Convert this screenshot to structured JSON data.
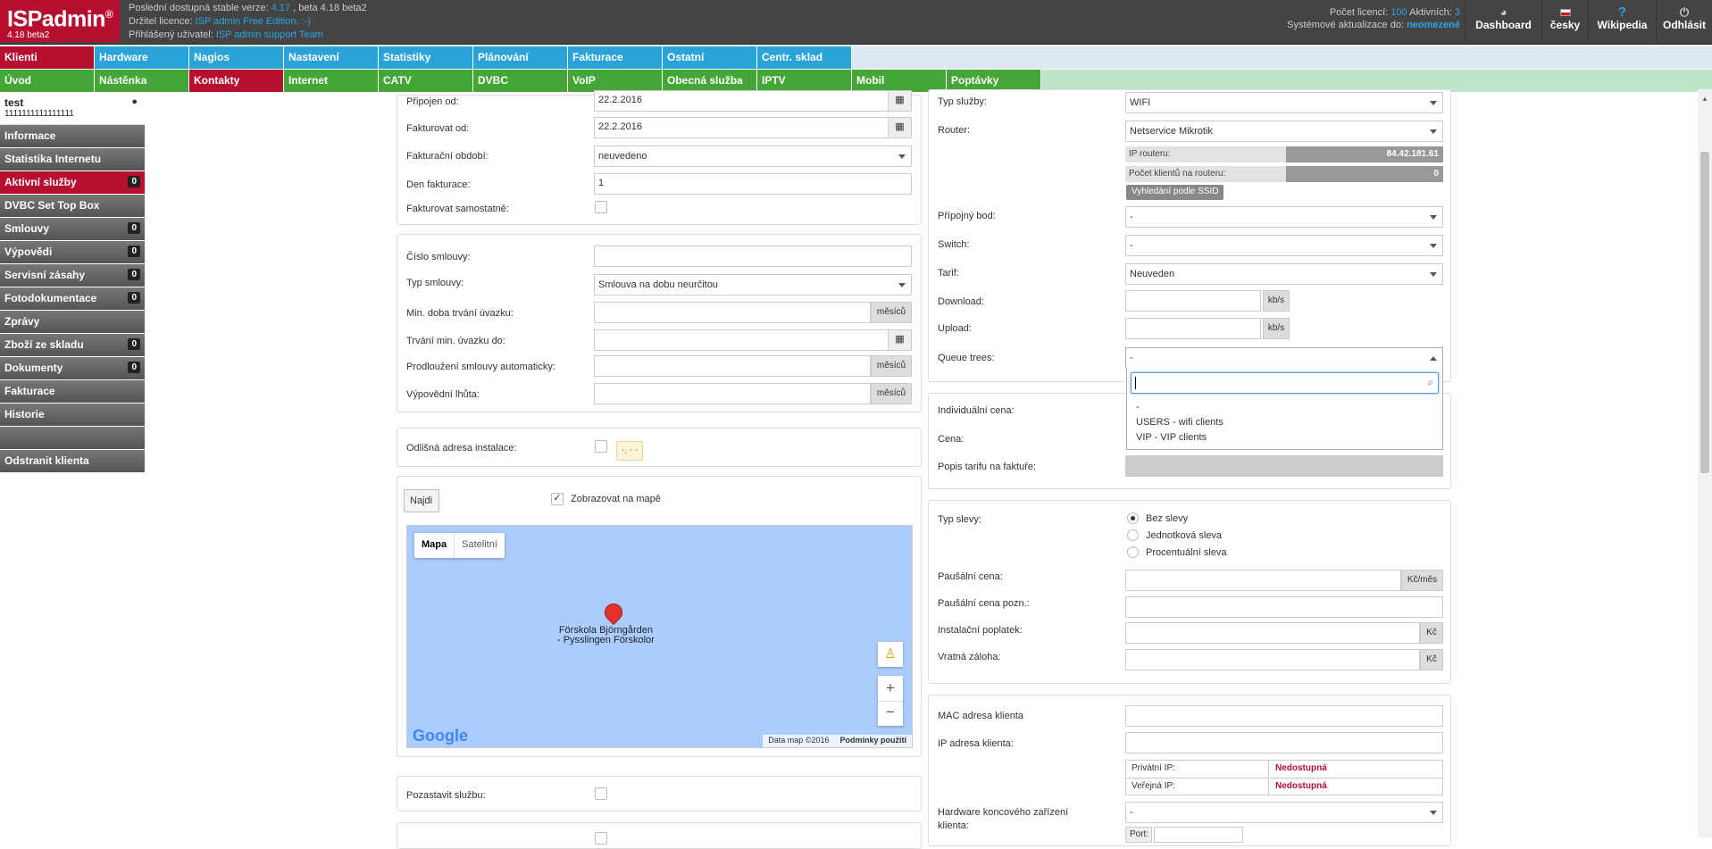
{
  "logo": {
    "name": "ISPadmin",
    "reg": "®",
    "version": "4.18 beta2"
  },
  "info": {
    "line1_pre": "Poslední dostupná stable verze: ",
    "line1_ver": "4.17",
    "line1_post": " , beta 4.18 beta2",
    "line2_pre": "Držitel licence: ",
    "line2_val": "ISP admin Free Edition, :-)",
    "line3_pre": "Přihlášený uživatel: ",
    "line3_val": "ISP admin support Team"
  },
  "rightinfo": {
    "l1_pre": "Počet licencí: ",
    "l1_a": "100",
    "l1_mid": " Aktivních: ",
    "l1_b": "3",
    "l2_pre": "Systémové aktualizace do: ",
    "l2_val": "neomezené"
  },
  "topbuttons": [
    "Dashboard",
    "česky",
    "Wikipedia",
    "Odhlásit"
  ],
  "menu1": [
    "Klienti",
    "Hardware",
    "Nagios",
    "Nastavení",
    "Statistiky",
    "Plánování",
    "Fakturace",
    "Ostatní",
    "Centr. sklad"
  ],
  "menu2": [
    "Úvod",
    "Nástěnka",
    "Kontakty",
    "Internet",
    "CATV",
    "DVBC",
    "VoIP",
    "Obecná služba",
    "IPTV",
    "Mobil",
    "Poptávky"
  ],
  "client": {
    "name": "test",
    "id": "1111111111111111"
  },
  "sidebar": [
    {
      "label": "Informace",
      "count": ""
    },
    {
      "label": "Statistika Internetu",
      "count": ""
    },
    {
      "label": "Aktivní služby",
      "count": "0"
    },
    {
      "label": "DVBC Set Top Box",
      "count": ""
    },
    {
      "label": "Smlouvy",
      "count": "0"
    },
    {
      "label": "Výpovědi",
      "count": "0"
    },
    {
      "label": "Servisní zásahy",
      "count": "0"
    },
    {
      "label": "Fotodokumentace",
      "count": "0"
    },
    {
      "label": "Zprávy",
      "count": ""
    },
    {
      "label": "Zboží ze skladu",
      "count": "0"
    },
    {
      "label": "Dokumenty",
      "count": "0"
    },
    {
      "label": "Fakturace",
      "count": ""
    },
    {
      "label": "Historie",
      "count": ""
    },
    {
      "label": "",
      "count": ""
    },
    {
      "label": "Odstranit klienta",
      "count": ""
    }
  ],
  "left": {
    "pripojen_od": {
      "label": "Připojen od:",
      "value": "22.2.2016"
    },
    "fakturovat_od": {
      "label": "Fakturovat od:",
      "value": "22.2.2016"
    },
    "fakt_obdobi": {
      "label": "Fakturační období:",
      "value": "neuvedeno"
    },
    "den_fakturace": {
      "label": "Den fakturace:",
      "value": "1"
    },
    "fakt_samostatne": {
      "label": "Fakturovat samostatně:"
    },
    "cislo_smlouvy": {
      "label": "Číslo smlouvy:",
      "value": ""
    },
    "typ_smlouvy": {
      "label": "Typ smlouvy:",
      "value": "Smlouva na dobu neurčitou"
    },
    "min_doba": {
      "label": "Min. doba trvání úvazku:",
      "unit": "měsíců"
    },
    "trvani_min": {
      "label": "Trvání min. úvazku do:"
    },
    "prodlouzeni": {
      "label": "Prodloužení smlouvy automaticky:",
      "unit": "měsíců"
    },
    "vypovedni": {
      "label": "Výpovědní lhůta:",
      "unit": "měsíců"
    },
    "odlisna": {
      "label": "Odlišná adresa instalace:",
      "tag": "-, - -"
    },
    "najdi": "Najdi",
    "zobrazovat": "Zobrazovat na mapě",
    "check_mark": "✓",
    "map": {
      "tab_mapa": "Mapa",
      "tab_satelit": "Satelitní",
      "place1": "Förskola Björngården",
      "place2": "- Pysslingen Förskolor",
      "logo": "Google",
      "data": "Data map ©2016",
      "terms": "Podmínky použití",
      "zoom_in": "+",
      "zoom_out": "−"
    },
    "pozastavit": "Pozastavit službu:"
  },
  "right": {
    "typ_sluzby": {
      "label": "Typ služby:",
      "value": "WIFI"
    },
    "router": {
      "label": "Router:",
      "value": "Netservice Mikrotik"
    },
    "ip_routeru": {
      "label": "IP routeru:",
      "value": "84.42.181.61"
    },
    "pocet_klientu": {
      "label": "Počet klientů na routeru:",
      "value": "0"
    },
    "ssid_btn": "Vyhledání podle SSID",
    "pripojny_bod": {
      "label": "Přípojný bod:",
      "value": "-"
    },
    "switch": {
      "label": "Switch:",
      "value": "-"
    },
    "tarif": {
      "label": "Tarif:",
      "value": "Neuveden"
    },
    "download": {
      "label": "Download:",
      "unit": "kb/s"
    },
    "upload": {
      "label": "Upload:",
      "unit": "kb/s"
    },
    "queue": {
      "label": "Queue trees:",
      "value": "-",
      "options": [
        "-",
        "USERS - wifi clients",
        "VIP - VIP clients"
      ]
    },
    "individualni": "Individuální cena:",
    "cena": "Cena:",
    "popis": "Popis tarifu na faktuře:",
    "typ_slevy": {
      "label": "Typ slevy:",
      "options": [
        "Bez slevy",
        "Jednotková sleva",
        "Procentuální sleva"
      ]
    },
    "pausalni": {
      "label": "Paušální cena:",
      "unit": "Kč/měs"
    },
    "pausalni_pozn": "Paušální cena pozn.:",
    "instalacni": {
      "label": "Instalační poplatek:",
      "unit": "Kč"
    },
    "vratna": {
      "label": "Vratná záloha:",
      "unit": "Kč"
    },
    "mac": "MAC adresa klienta",
    "ip": "IP adresa klienta:",
    "privatni": {
      "label": "Privátní IP:",
      "value": "Nedostupná"
    },
    "verejna": {
      "label": "Veřejná IP:",
      "value": "Nedostupná"
    },
    "hw": {
      "label1": "Hardware koncového zařízení",
      "label2": "klienta:",
      "value": "-"
    },
    "port": "Port:"
  },
  "colors": {
    "red": "#b70f2f",
    "blue": "#2aa3d9",
    "green": "#43a636"
  }
}
